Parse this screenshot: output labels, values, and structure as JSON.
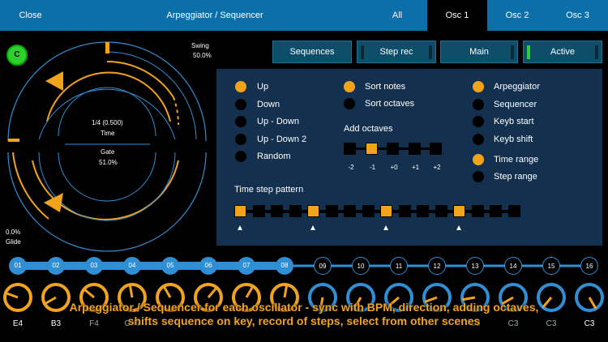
{
  "header": {
    "close_label": "Close",
    "title": "Arpeggiator / Sequencer",
    "tabs": [
      "All",
      "Osc 1",
      "Osc 2",
      "Osc 3"
    ]
  },
  "left": {
    "c_badge": "C",
    "swing_label": "Swing",
    "swing_value": "50.0%",
    "time_value": "1/4 (0.500)",
    "time_label": "Time",
    "gate_label": "Gate",
    "gate_value": "51.0%",
    "glide_value": "0.0%",
    "glide_label": "Glide"
  },
  "buttons": {
    "sequences": "Sequences",
    "step_rec": "Step rec",
    "main": "Main",
    "active": "Active"
  },
  "panel": {
    "directions": [
      {
        "label": "Up",
        "on": true
      },
      {
        "label": "Down",
        "on": false
      },
      {
        "label": "Up - Down",
        "on": false
      },
      {
        "label": "Up - Down 2",
        "on": false
      },
      {
        "label": "Random",
        "on": false
      }
    ],
    "sort_notes": "Sort notes",
    "sort_octaves": "Sort octaves",
    "add_octaves": "Add octaves",
    "octave_values": [
      "-2",
      "-1",
      "+0",
      "+1",
      "+2"
    ],
    "octave_selected": 1,
    "modes": [
      {
        "label": "Arpeggiator",
        "on": true
      },
      {
        "label": "Sequencer",
        "on": false
      },
      {
        "label": "Keyb start",
        "on": false
      },
      {
        "label": "Keyb shift",
        "on": false
      }
    ],
    "ranges": [
      {
        "label": "Time range",
        "on": true
      },
      {
        "label": "Step range",
        "on": false
      }
    ],
    "time_step_pattern": "Time step pattern"
  },
  "steps": [
    "01",
    "02",
    "03",
    "04",
    "05",
    "06",
    "07",
    "08",
    "09",
    "10",
    "11",
    "12",
    "13",
    "14",
    "15",
    "16"
  ],
  "steps_active_count": 8,
  "notes": [
    "E4",
    "B3",
    "F4",
    "G#4",
    "",
    "",
    "",
    "",
    "",
    "",
    "",
    "",
    "C3",
    "C3",
    "C3",
    "C3"
  ],
  "caption": {
    "line1": "Arpeggiator / Sequencer for each oscillator - sync with BPM, direction, adding octaves,",
    "line2": "shifts sequence on key, record of steps, select from other scenes"
  },
  "colors": {
    "accent": "#f2a31c",
    "header": "#0d6fa8",
    "panel": "#14304f",
    "active_green": "#2ed02e"
  }
}
